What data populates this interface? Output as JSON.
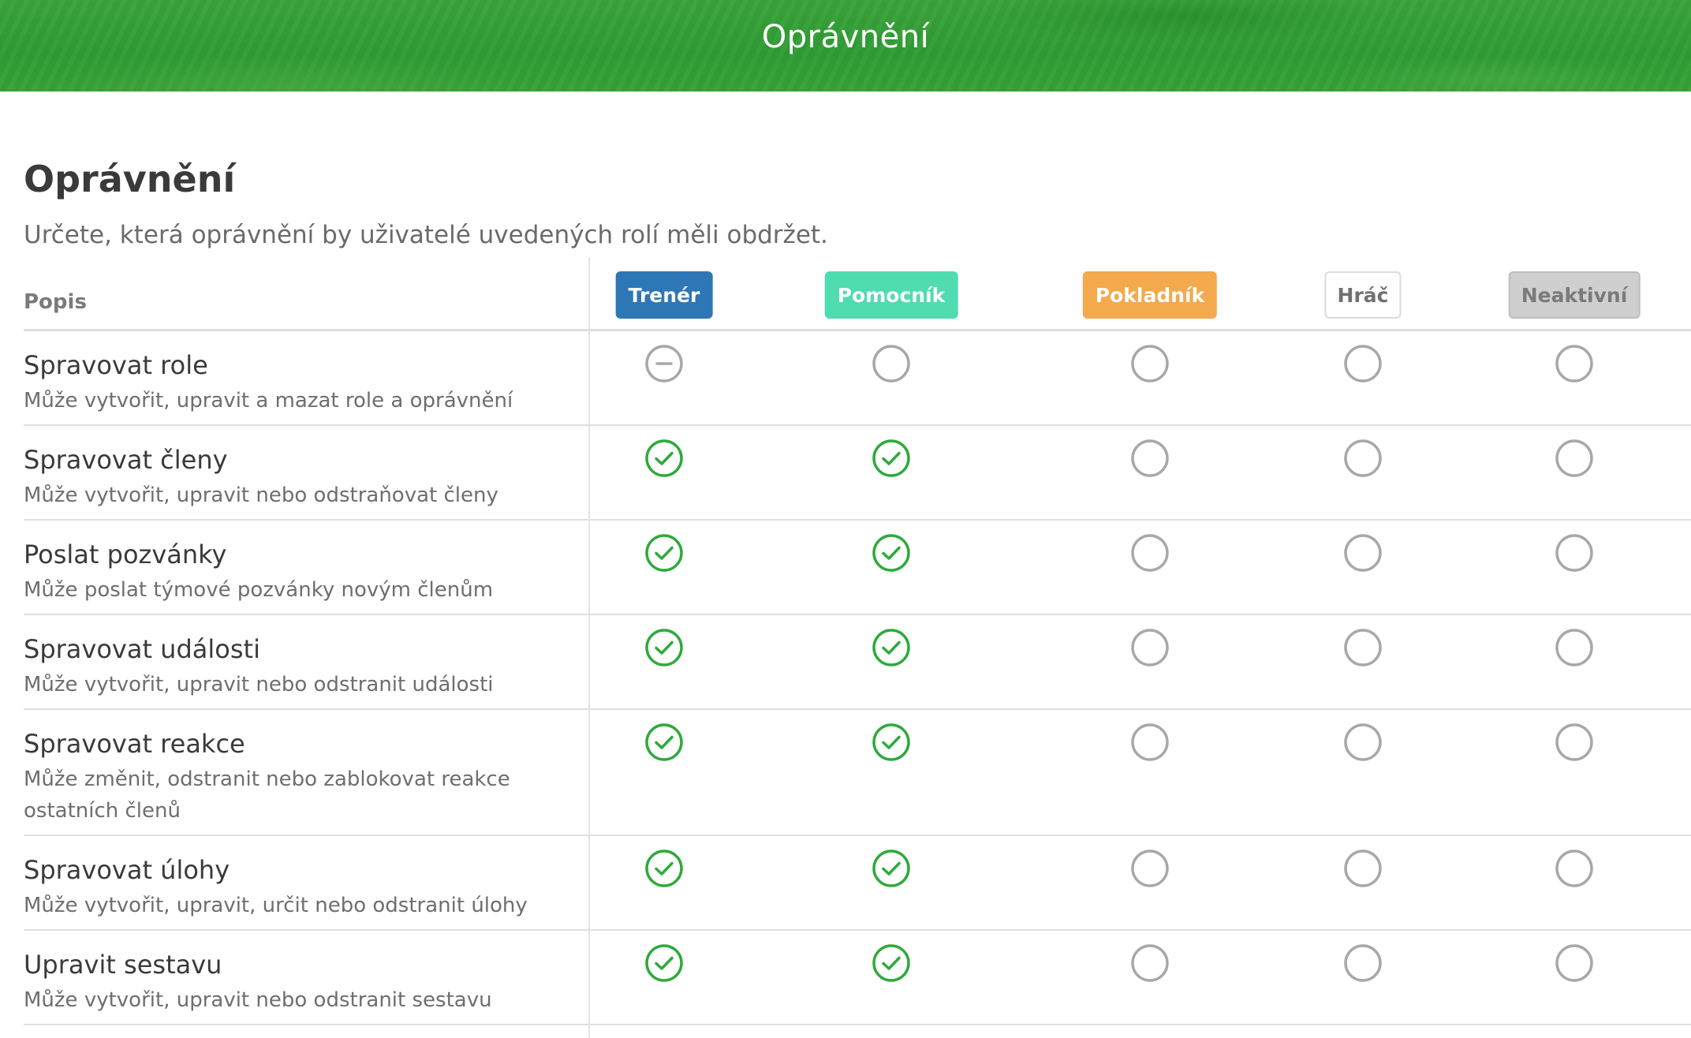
{
  "header": {
    "title": "Oprávnění"
  },
  "page": {
    "heading": "Oprávnění",
    "subheading": "Určete, která oprávnění by uživatelé uvedených rolí měli obdržet."
  },
  "table": {
    "description_header": "Popis",
    "roles": [
      {
        "label": "Trenér",
        "bg": "#2e77b6",
        "fg": "#ffffff",
        "border": "#2e77b6"
      },
      {
        "label": "Pomocník",
        "bg": "#4fdcb0",
        "fg": "#ffffff",
        "border": "#4fdcb0"
      },
      {
        "label": "Pokladník",
        "bg": "#f3a94c",
        "fg": "#ffffff",
        "border": "#f3a94c"
      },
      {
        "label": "Hráč",
        "bg": "#ffffff",
        "fg": "#707070",
        "border": "#dcdcdc"
      },
      {
        "label": "Neaktivní",
        "bg": "#cfcfcf",
        "fg": "#7a7a7a",
        "border": "#bdbdbd"
      }
    ],
    "rows": [
      {
        "title": "Spravovat role",
        "description": "Může vytvořit, upravit a mazat role a oprávnění",
        "states": [
          "locked",
          "off",
          "off",
          "off",
          "off"
        ]
      },
      {
        "title": "Spravovat členy",
        "description": "Může vytvořit, upravit nebo odstraňovat členy",
        "states": [
          "on",
          "on",
          "off",
          "off",
          "off"
        ]
      },
      {
        "title": "Poslat pozvánky",
        "description": "Může poslat týmové pozvánky novým členům",
        "states": [
          "on",
          "on",
          "off",
          "off",
          "off"
        ]
      },
      {
        "title": "Spravovat události",
        "description": "Může vytvořit, upravit nebo odstranit události",
        "states": [
          "on",
          "on",
          "off",
          "off",
          "off"
        ]
      },
      {
        "title": "Spravovat reakce",
        "description": "Může změnit, odstranit nebo zablokovat reakce ostatních členů",
        "states": [
          "on",
          "on",
          "off",
          "off",
          "off"
        ]
      },
      {
        "title": "Spravovat úlohy",
        "description": "Může vytvořit, upravit, určit nebo odstranit úlohy",
        "states": [
          "on",
          "on",
          "off",
          "off",
          "off"
        ]
      },
      {
        "title": "Upravit sestavu",
        "description": "Může vytvořit, upravit nebo odstranit sestavu",
        "states": [
          "on",
          "on",
          "off",
          "off",
          "off"
        ]
      }
    ]
  },
  "colors": {
    "check_green": "#2eaa3c",
    "circle_gray": "#a8a8a8",
    "header_green": "#36a236"
  },
  "icons": {
    "on": "check-circle-icon",
    "off": "empty-circle-icon",
    "locked": "minus-circle-icon"
  }
}
